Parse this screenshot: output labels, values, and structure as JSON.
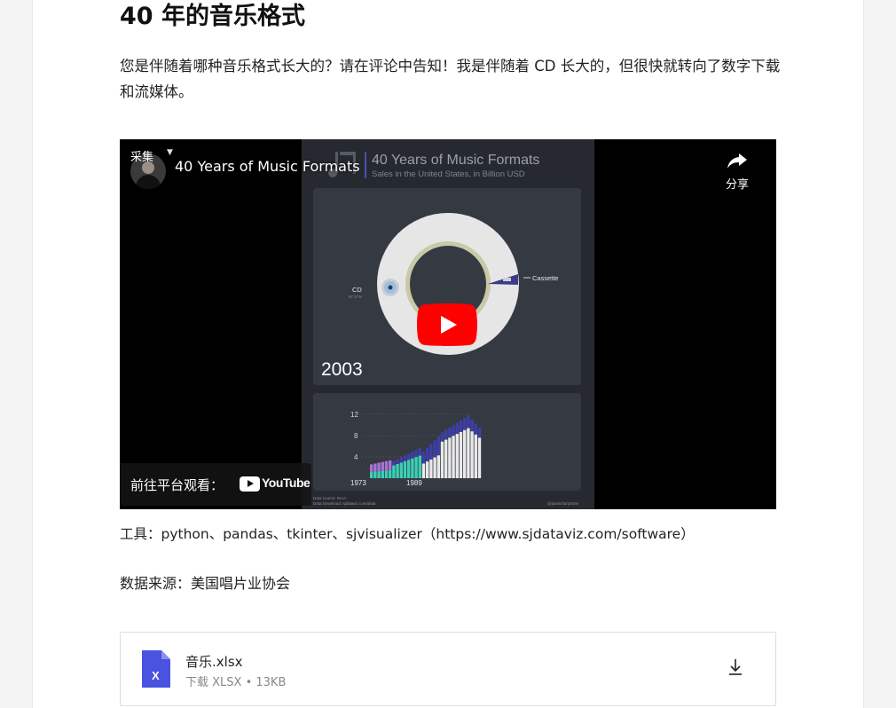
{
  "article": {
    "title": "40 年的音乐格式",
    "intro": "您是伴随着哪种音乐格式长大的？请在评论中告知！我是伴随着 CD 长大的，但很快就转向了数字下载和流媒体。",
    "tools_line": "工具：python、pandas、tkinter、sjvisualizer（https://www.sjdataviz.com/software）",
    "source_line": "数据来源：美国唱片业协会"
  },
  "video": {
    "channel_name": "采集",
    "title": "40 Years of Music Formats",
    "share_label": "分享",
    "share_icon": "share-arrow-icon",
    "play_icon": "youtube-play-icon",
    "watch_on_label": "前往平台观看：",
    "platform_logo": "YouTube",
    "frame": {
      "chart_title": "40 Years of Music Formats",
      "chart_subtitle": "Sales in the United States, in Billion USD",
      "year": "2003",
      "donut_labels": [
        "CD",
        "Cassette"
      ],
      "cd_sub": "97.17%",
      "bar_ticks": [
        "12",
        "8",
        "4"
      ],
      "bar_x_labels": [
        "1973",
        "1989"
      ],
      "footer_left_1": "Data source: RIAA",
      "footer_left_2": "Data Download: sjdataviz.com/data",
      "footer_right": "@plainchartplotte",
      "colors": {
        "panel": "#2b2f36",
        "panel_inner": "#353a42",
        "cd": "#e6e6e6",
        "cassette": "#3b3a8c",
        "vinyl": "#c9c9a8",
        "bar_teal": "#3ccfb6",
        "bar_violet": "#a874d8",
        "bar_white": "#e9e9e9",
        "bar_indigo": "#3d3fa8"
      }
    }
  },
  "attachment": {
    "file_name": "音乐.xlsx",
    "meta": "下载 XLSX • 13KB",
    "icon_letter": "X",
    "icon_color": "#4a52e0",
    "download_icon": "download-arrow-icon"
  }
}
